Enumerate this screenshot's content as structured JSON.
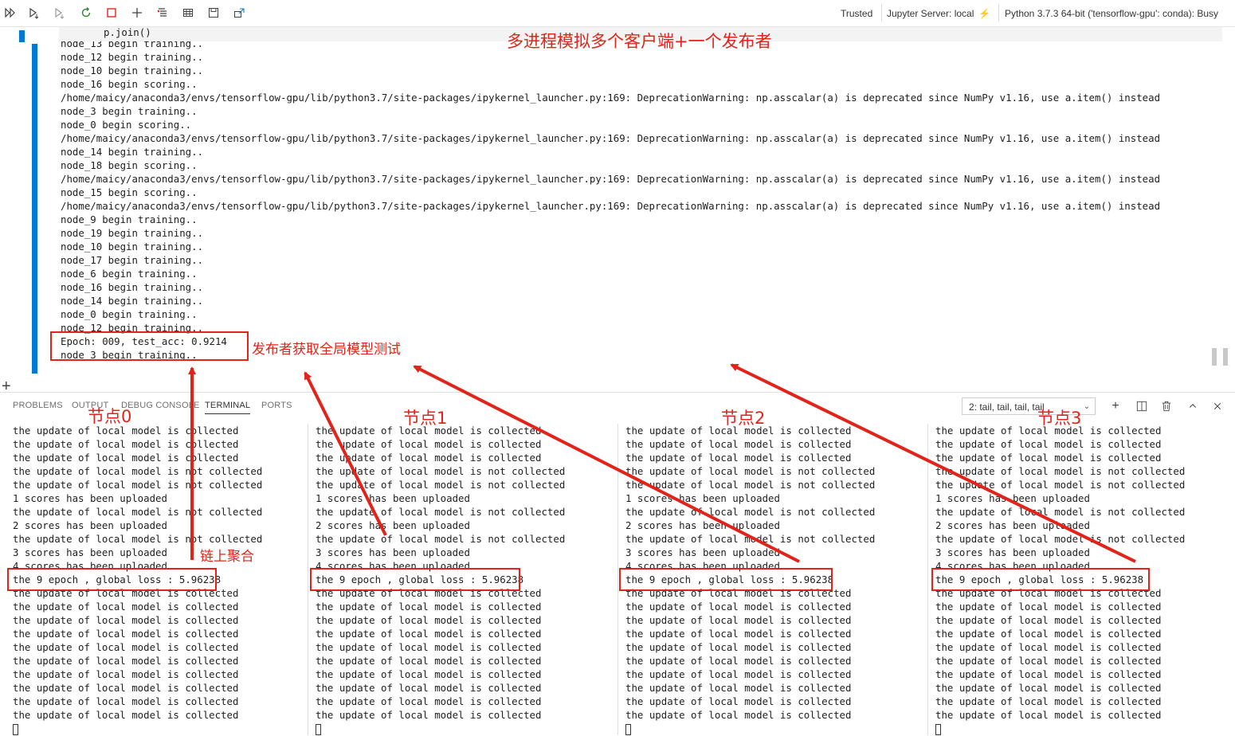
{
  "toolbar": {
    "icons": [
      "run-all-icon",
      "run-above-icon",
      "run-below-icon",
      "restart-kernel-icon",
      "interrupt-icon",
      "add-cell-icon",
      "clear-output-icon",
      "variables-icon",
      "save-icon",
      "export-icon"
    ],
    "trusted": "Trusted",
    "server": "Jupyter Server: local",
    "kernel": "Python 3.7.3 64-bit ('tensorflow-gpu': conda): Busy"
  },
  "notebook": {
    "code_line": "p.join()",
    "output_lines": [
      "node_13 begin training..",
      "node_12 begin training..",
      "node_10 begin training..",
      "node_16 begin scoring..",
      "/home/maicy/anaconda3/envs/tensorflow-gpu/lib/python3.7/site-packages/ipykernel_launcher.py:169: DeprecationWarning: np.asscalar(a) is deprecated since NumPy v1.16, use a.item() instead",
      "node_3 begin training..",
      "node_0 begin scoring..",
      "/home/maicy/anaconda3/envs/tensorflow-gpu/lib/python3.7/site-packages/ipykernel_launcher.py:169: DeprecationWarning: np.asscalar(a) is deprecated since NumPy v1.16, use a.item() instead",
      "node_14 begin training..",
      "node_18 begin scoring..",
      "/home/maicy/anaconda3/envs/tensorflow-gpu/lib/python3.7/site-packages/ipykernel_launcher.py:169: DeprecationWarning: np.asscalar(a) is deprecated since NumPy v1.16, use a.item() instead",
      "node_15 begin scoring..",
      "/home/maicy/anaconda3/envs/tensorflow-gpu/lib/python3.7/site-packages/ipykernel_launcher.py:169: DeprecationWarning: np.asscalar(a) is deprecated since NumPy v1.16, use a.item() instead",
      "node_9 begin training..",
      "node_19 begin training..",
      "node_10 begin training..",
      "node_17 begin training..",
      "node_6 begin training..",
      "node_16 begin training..",
      "node_14 begin training..",
      "node_0 begin training..",
      "node_12 begin training..",
      "Epoch: 009, test_acc: 0.9214",
      "node_3 begin training.."
    ]
  },
  "panel": {
    "tabs": [
      "PROBLEMS",
      "OUTPUT",
      "DEBUG CONSOLE",
      "TERMINAL",
      "PORTS"
    ],
    "active_tab": "TERMINAL",
    "terminal_select": "2: tail, tail, tail, tail",
    "icons": [
      "new-terminal-icon",
      "split-terminal-icon",
      "kill-terminal-icon",
      "maximize-panel-icon",
      "close-panel-icon"
    ]
  },
  "terminals": [
    {
      "lines": [
        "the update of local model is collected",
        "the update of local model is collected",
        "the update of local model is collected",
        "the update of local model is not collected",
        "the update of local model is not collected",
        "1 scores has been uploaded",
        "the update of local model is not collected",
        "2 scores has been uploaded",
        "the update of local model is not collected",
        "3 scores has been uploaded",
        "4 scores has been uploaded",
        "the 9 epoch , global loss : 5.96238",
        "the update of local model is collected",
        "the update of local model is collected",
        "the update of local model is collected",
        "the update of local model is collected",
        "the update of local model is collected",
        "the update of local model is collected",
        "the update of local model is collected",
        "the update of local model is collected",
        "the update of local model is collected",
        "the update of local model is collected"
      ]
    },
    {
      "lines": [
        "the update of local model is collected",
        "the update of local model is collected",
        "the update of local model is collected",
        "the update of local model is not collected",
        "the update of local model is not collected",
        "1 scores has been uploaded",
        "the update of local model is not collected",
        "2 scores has been uploaded",
        "the update of local model is not collected",
        "3 scores has been uploaded",
        "4 scores has been uploaded",
        "the 9 epoch , global loss : 5.96238",
        "the update of local model is collected",
        "the update of local model is collected",
        "the update of local model is collected",
        "the update of local model is collected",
        "the update of local model is collected",
        "the update of local model is collected",
        "the update of local model is collected",
        "the update of local model is collected",
        "the update of local model is collected",
        "the update of local model is collected"
      ]
    },
    {
      "lines": [
        "the update of local model is collected",
        "the update of local model is collected",
        "the update of local model is collected",
        "the update of local model is not collected",
        "the update of local model is not collected",
        "1 scores has been uploaded",
        "the update of local model is not collected",
        "2 scores has been uploaded",
        "the update of local model is not collected",
        "3 scores has been uploaded",
        "4 scores has been uploaded",
        "the 9 epoch , global loss : 5.96238",
        "the update of local model is collected",
        "the update of local model is collected",
        "the update of local model is collected",
        "the update of local model is collected",
        "the update of local model is collected",
        "the update of local model is collected",
        "the update of local model is collected",
        "the update of local model is collected",
        "the update of local model is collected",
        "the update of local model is collected"
      ]
    },
    {
      "lines": [
        "the update of local model is collected",
        "the update of local model is collected",
        "the update of local model is collected",
        "the update of local model is not collected",
        "the update of local model is not collected",
        "1 scores has been uploaded",
        "the update of local model is not collected",
        "2 scores has been uploaded",
        "the update of local model is not collected",
        "3 scores has been uploaded",
        "4 scores has been uploaded",
        "the 9 epoch , global loss : 5.96238",
        "the update of local model is collected",
        "the update of local model is collected",
        "the update of local model is collected",
        "the update of local model is collected",
        "the update of local model is collected",
        "the update of local model is collected",
        "the update of local model is collected",
        "the update of local model is collected",
        "the update of local model is collected",
        "the update of local model is collected"
      ]
    }
  ],
  "annotations": {
    "title": "多进程模拟多个客户端+一个发布者",
    "publisher": "发布者获取全局模型测试",
    "node0": "节点0",
    "node1": "节点1",
    "node2": "节点2",
    "node3": "节点3",
    "onchain": "链上聚合",
    "color": "#e2231a"
  }
}
